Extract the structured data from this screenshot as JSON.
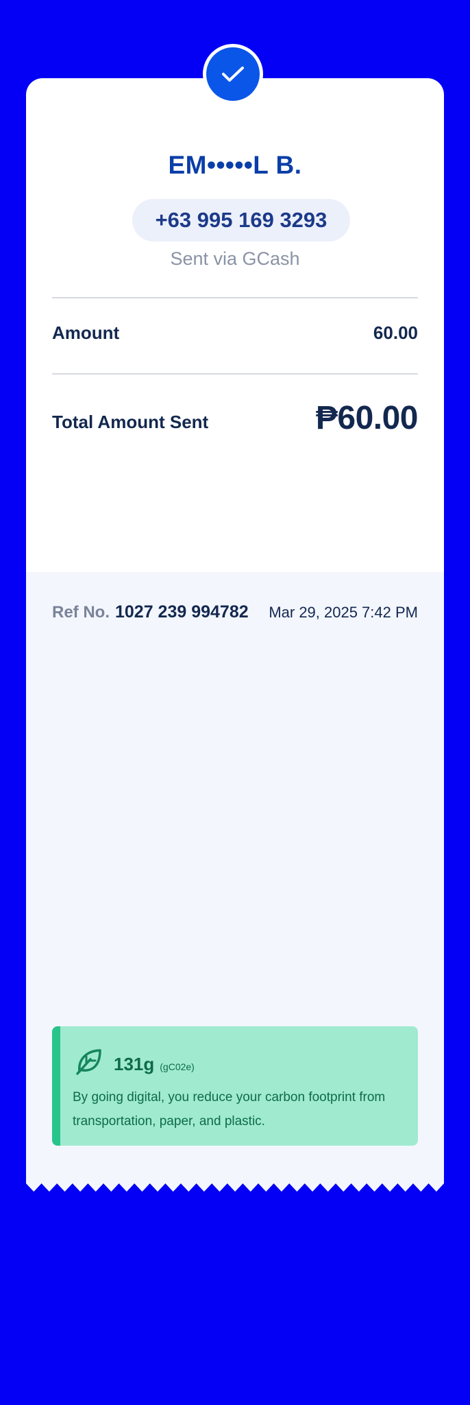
{
  "recipient": {
    "name": "EM•••••L B.",
    "phone": "+63 995 169 3293",
    "sent_via": "Sent via GCash"
  },
  "amount": {
    "label": "Amount",
    "value": "60.00"
  },
  "total": {
    "label": "Total Amount Sent",
    "value": "₱60.00"
  },
  "reference": {
    "label": "Ref No.",
    "number": "1027 239 994782",
    "datetime": "Mar 29, 2025 7:42 PM"
  },
  "eco": {
    "value": "131g",
    "unit": "(gC02e)",
    "message": "By going digital, you reduce your carbon footprint from transportation, paper, and plastic."
  },
  "colors": {
    "background": "#0300f5",
    "accent": "#0a56e9",
    "eco_box": "#a0ead0",
    "eco_stripe": "#27c58b"
  },
  "icons": {
    "status": "checkmark-icon",
    "eco": "leaf-icon"
  }
}
